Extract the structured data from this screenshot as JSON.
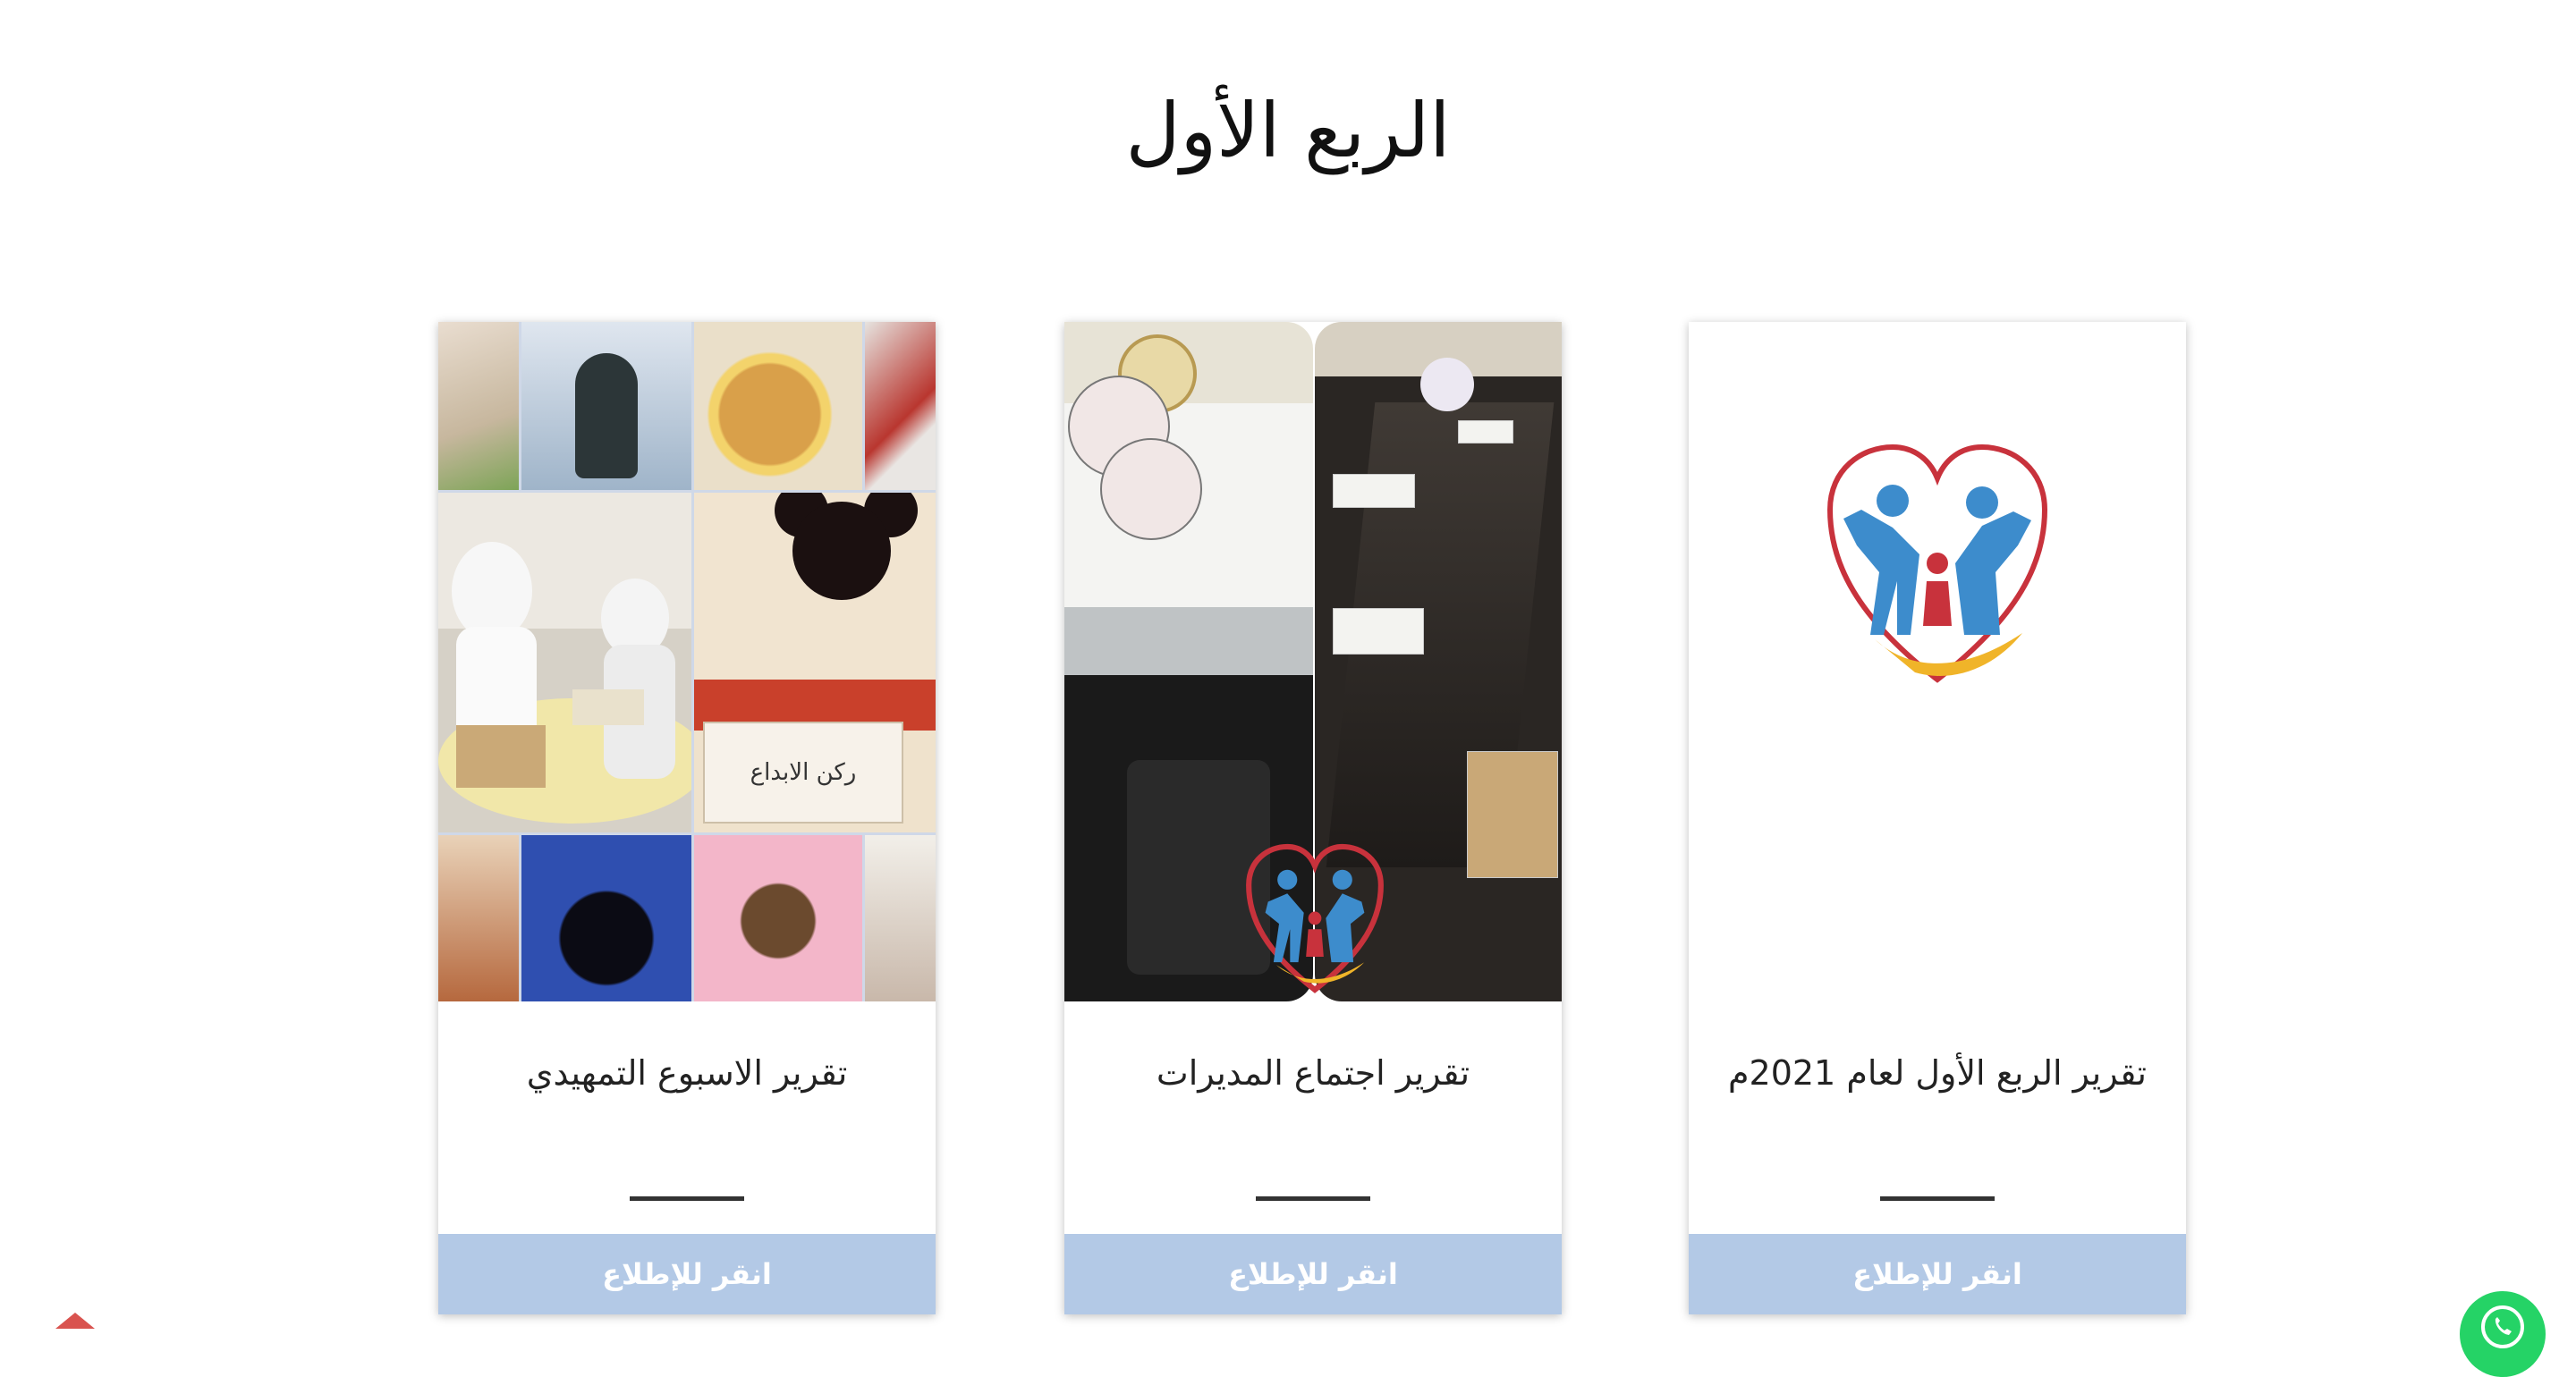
{
  "page": {
    "title": "الربع الأول"
  },
  "cards": [
    {
      "title": "تقرير الاسبوع التمهيدي",
      "button_label": "انقر للإطلاع",
      "image_sign_text": "ركن الابداع"
    },
    {
      "title": "تقرير اجتماع المديرات",
      "button_label": "انقر للإطلاع"
    },
    {
      "title": "تقرير الربع الأول لعام 2021م",
      "button_label": "انقر للإطلاع"
    }
  ],
  "colors": {
    "button_bg": "#b3c9e6",
    "button_text": "#ffffff",
    "logo_heart": "#c8323c",
    "logo_figures": "#3d8ccc",
    "logo_hand": "#f0b429",
    "whatsapp": "#25d366"
  },
  "icons": {
    "whatsapp": "whatsapp-icon",
    "scroll_top": "chevron-up-icon"
  }
}
